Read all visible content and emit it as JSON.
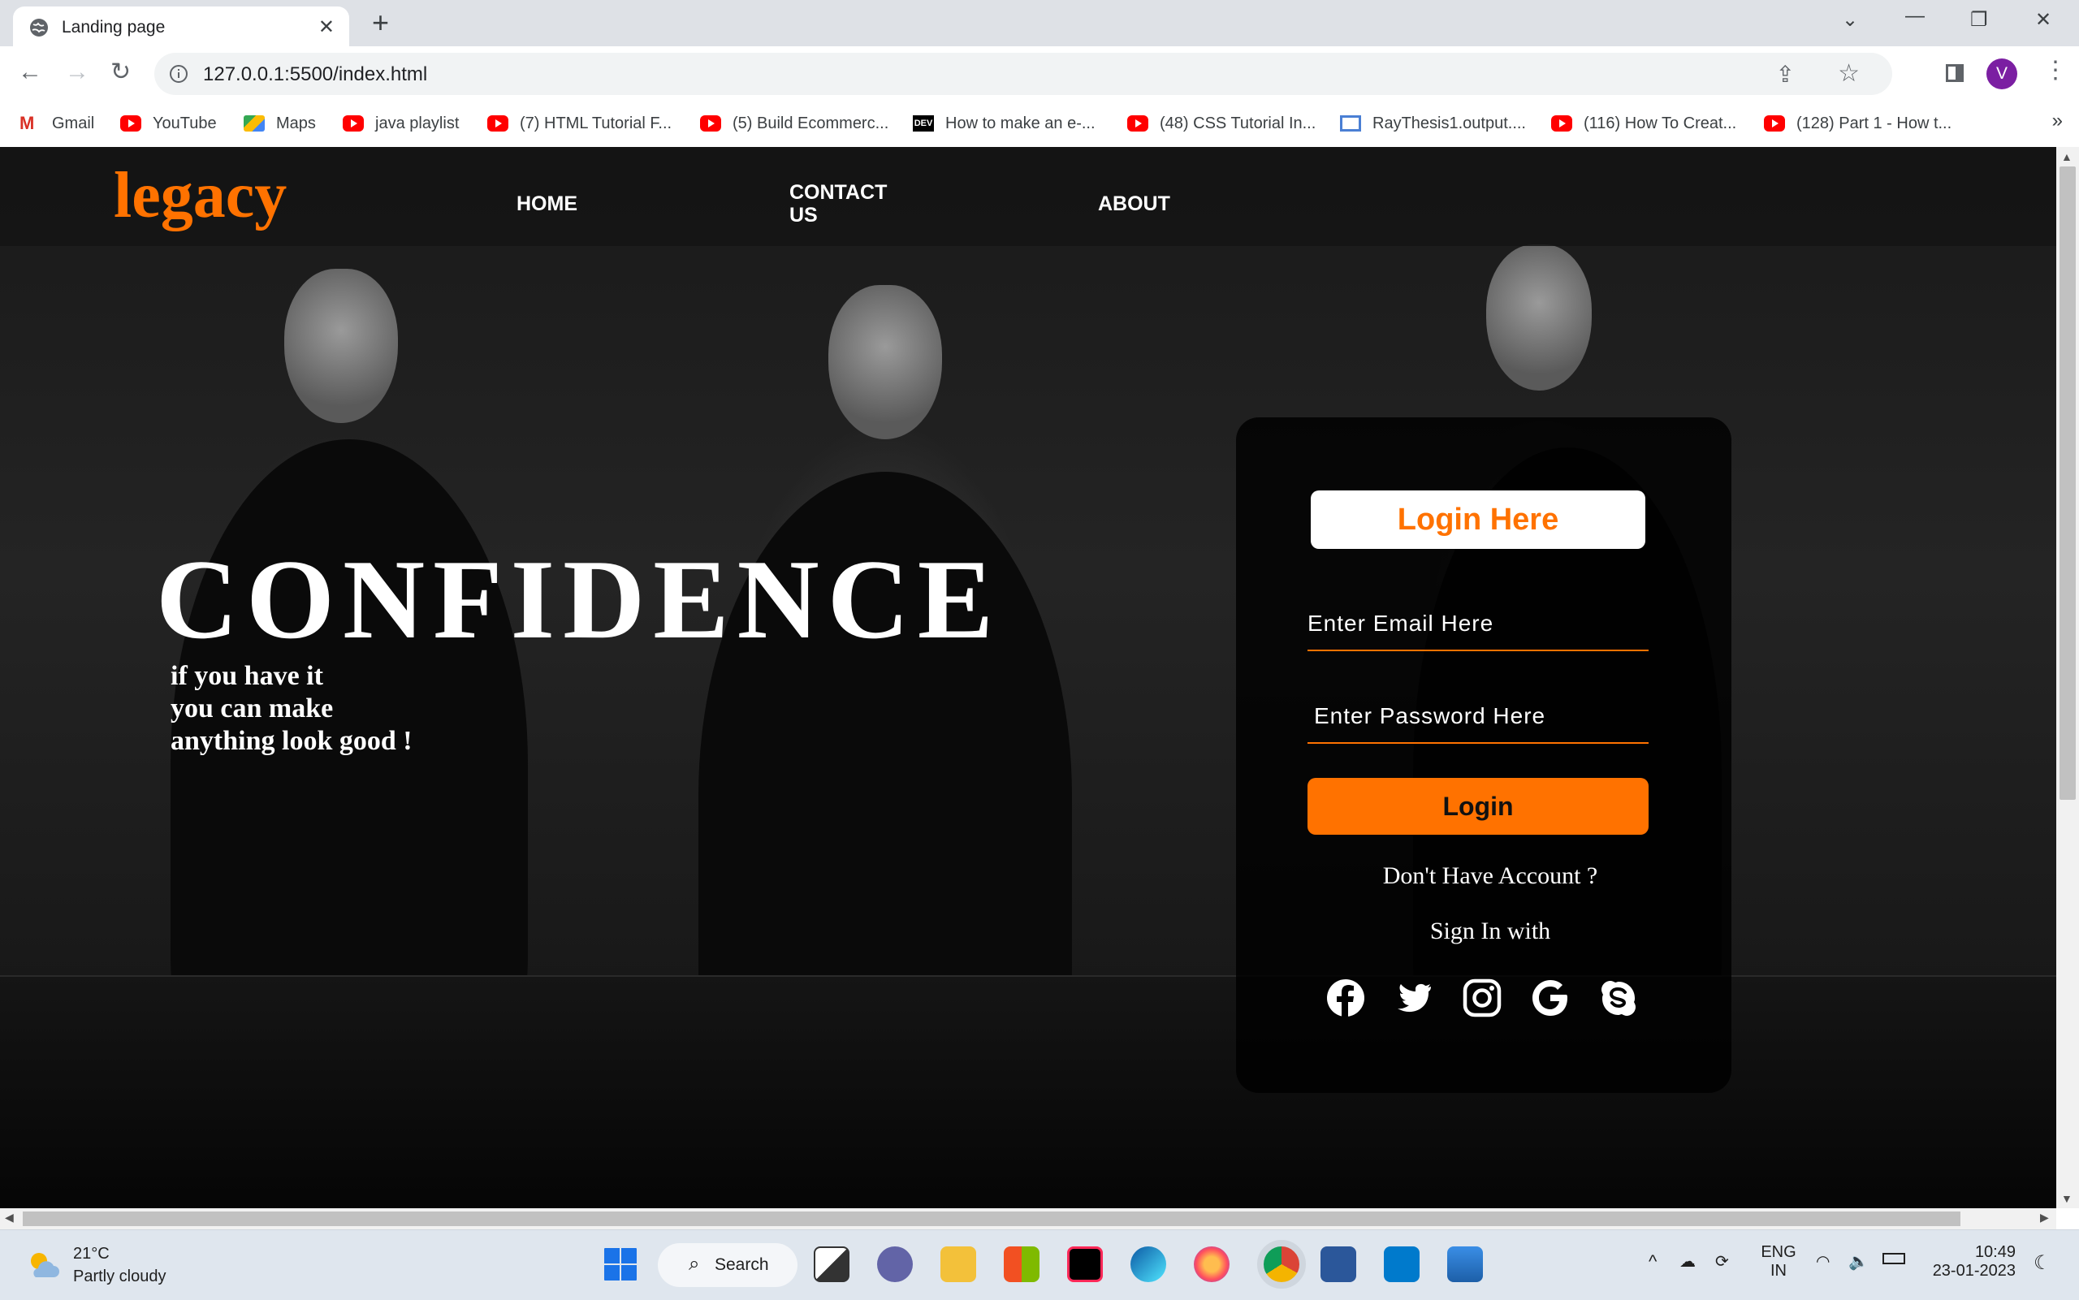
{
  "browser": {
    "tab_title": "Landing page",
    "url": "127.0.0.1:5500/index.html",
    "avatar_letter": "V",
    "bookmarks": [
      {
        "label": "Gmail",
        "icon": "gmail-icon"
      },
      {
        "label": "YouTube",
        "icon": "youtube-icon"
      },
      {
        "label": "Maps",
        "icon": "maps-icon"
      },
      {
        "label": "java playlist",
        "icon": "youtube-icon"
      },
      {
        "label": "(7) HTML Tutorial F...",
        "icon": "youtube-icon"
      },
      {
        "label": "(5) Build Ecommerc...",
        "icon": "youtube-icon"
      },
      {
        "label": "How to make an e-...",
        "icon": "dev-icon"
      },
      {
        "label": "(48) CSS Tutorial In...",
        "icon": "youtube-icon"
      },
      {
        "label": "RayThesis1.output....",
        "icon": "document-icon"
      },
      {
        "label": "(116) How To Creat...",
        "icon": "youtube-icon"
      },
      {
        "label": "(128) Part 1 - How t...",
        "icon": "youtube-icon"
      }
    ]
  },
  "page": {
    "logo": "legacy",
    "nav": {
      "home": "HOME",
      "contact_line1": "CONTACT",
      "contact_line2": "US",
      "about": "ABOUT"
    },
    "hero": {
      "title": "CONFIDENCE",
      "line1": "if you have it",
      "line2": "you can make",
      "line3": "anything look good !"
    },
    "login": {
      "header": "Login Here",
      "email_placeholder": "Enter Email Here",
      "password_placeholder": "Enter Password Here",
      "button": "Login",
      "no_account": "Don't Have Account ?",
      "sign_in_with": "Sign In with",
      "socials": [
        "facebook-icon",
        "twitter-icon",
        "instagram-icon",
        "google-icon",
        "skype-icon"
      ]
    },
    "accent_color": "#ff7200"
  },
  "taskbar": {
    "temperature": "21°C",
    "condition": "Partly cloudy",
    "search_label": "Search",
    "lang_line1": "ENG",
    "lang_line2": "IN",
    "time": "10:49",
    "date": "23-01-2023"
  }
}
